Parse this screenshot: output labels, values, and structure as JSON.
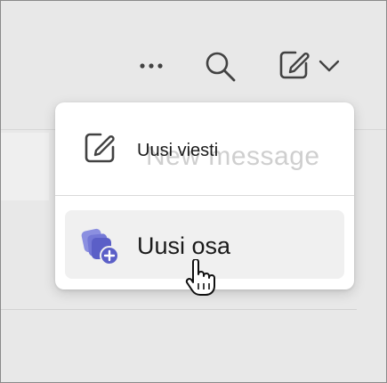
{
  "toolbar": {
    "more_icon": "more-horizontal-icon",
    "search_icon": "search-icon",
    "compose_icon": "compose-icon",
    "chevron_icon": "chevron-down-icon"
  },
  "menu": {
    "items": [
      {
        "label": "Uusi viesti",
        "ghost_label": "New message",
        "icon": "compose-icon"
      },
      {
        "label": "Uusi osa",
        "icon": "new-section-icon",
        "icon_color": "#5b5fc7",
        "highlighted": true
      }
    ]
  },
  "cursor": {
    "type": "hand-pointer"
  },
  "colors": {
    "background": "#e8e8e8",
    "menu_background": "#ffffff",
    "highlight": "#f0f0f0",
    "accent": "#5b5fc7",
    "text": "#1a1a1a",
    "icon": "#424242"
  }
}
